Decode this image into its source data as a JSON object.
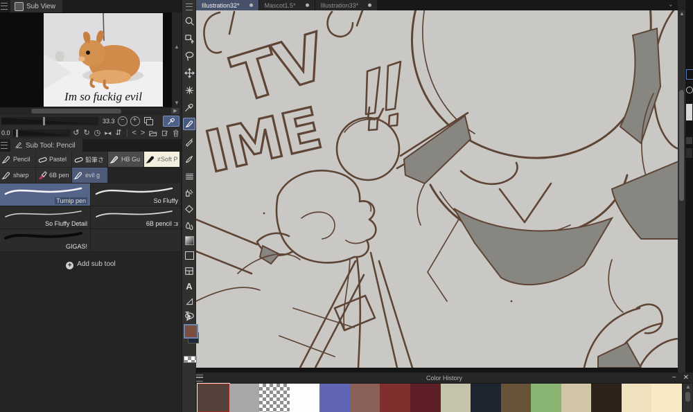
{
  "subview": {
    "tab_label": "Sub View",
    "caption": "Im so fuckig evil",
    "zoom_value": "33.3",
    "zoom_out": "−",
    "zoom_in": "+",
    "rotation_value": "0.0",
    "nav_icons": [
      "undo",
      "redo",
      "reset-time",
      "flip-horizontal",
      "fit-vertical",
      "previous",
      "next",
      "open-file",
      "edit-file",
      "delete"
    ]
  },
  "subtool": {
    "header": "Sub Tool: Pencil",
    "buttons": [
      {
        "label": "Pencil"
      },
      {
        "label": "Pastel"
      },
      {
        "label": "鉛筆さ"
      },
      {
        "label": "HB Gu"
      },
      {
        "label": "≠Soft P"
      },
      {
        "label": "sharp"
      },
      {
        "label": "6B pen"
      },
      {
        "label": "evil g"
      }
    ],
    "brushes": [
      {
        "name": "Turnip pen",
        "selected": true
      },
      {
        "name": "So Fluffy"
      },
      {
        "name": "So Fluffy Detail"
      },
      {
        "name": "6B pencil :з"
      },
      {
        "name": "GIGAS!"
      },
      {
        "name": ""
      }
    ],
    "add_label": "Add sub tool"
  },
  "toolbar": {
    "tools": [
      "zoom",
      "object",
      "lasso",
      "move",
      "magic-wand",
      "eyedropper",
      "pen",
      "pencil",
      "brush",
      "decoration",
      "airbrush",
      "eraser",
      "blend",
      "gradient",
      "figure",
      "frame",
      "text",
      "ruler",
      "balloon",
      "correct-line"
    ],
    "selected_tool": "pen",
    "main_color": "#7a4f3d",
    "sub_color": "#1d2736"
  },
  "canvas": {
    "tabs": [
      {
        "label": "Illustration32*",
        "active": true
      },
      {
        "label": "Mascot1.5*",
        "active": false
      },
      {
        "label": "Illustration33*",
        "active": false
      }
    ],
    "art_word1": "TV",
    "art_word2": "IME",
    "background": "#c9c8c5",
    "line_color": "#5e4536",
    "shade_color": "#878680"
  },
  "color_history": {
    "title": "Color History",
    "minimize": "−",
    "close": "✕",
    "colors": [
      "#54413a",
      "#a7a7a7",
      "transparent",
      "#fdfcfe",
      "#6066b4",
      "#8a6058",
      "#7f302e",
      "#5e2026",
      "#c6c3ad",
      "#1d2630",
      "#665338",
      "#8ab471",
      "#d0c5a6",
      "#2e231b",
      "#efe1bd",
      "#f6e9c4"
    ],
    "selected_index": 0
  }
}
